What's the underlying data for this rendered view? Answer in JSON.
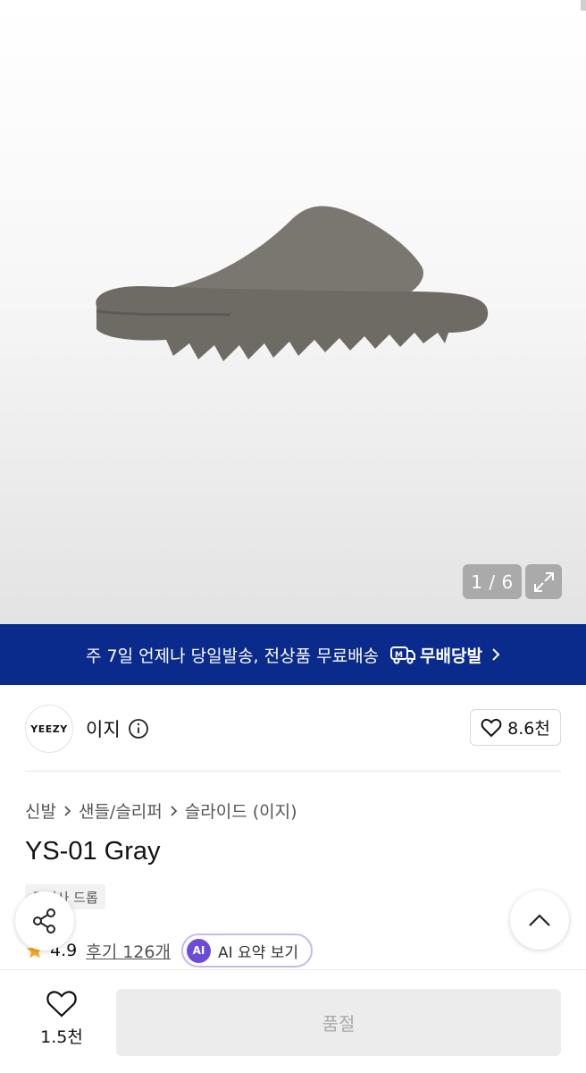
{
  "gallery": {
    "counter": "1 / 6",
    "image_alt": "Yeezy slide, gray"
  },
  "banner": {
    "text": "주 7일 언제나 당일발송, 전상품 무료배송",
    "badge_label": "무배당발"
  },
  "brand": {
    "logo_text": "YEEZY",
    "name": "이지",
    "like_count": "8.6천"
  },
  "breadcrumb": [
    "신발",
    "샌들/슬리퍼",
    "슬라이드 (이지)"
  ],
  "product": {
    "title": "YS-01 Gray",
    "tag": "무신사 드롭",
    "rating": "4.9",
    "reviews": "후기 126개",
    "ai_badge": "AI",
    "ai_summary": "AI 요약 보기"
  },
  "bottom": {
    "wish_count": "1.5천",
    "buy_label": "품절"
  },
  "colors": {
    "banner_bg": "#0a2a8c",
    "star": "#f5a623",
    "ai_purple": "#6b4bd8"
  }
}
